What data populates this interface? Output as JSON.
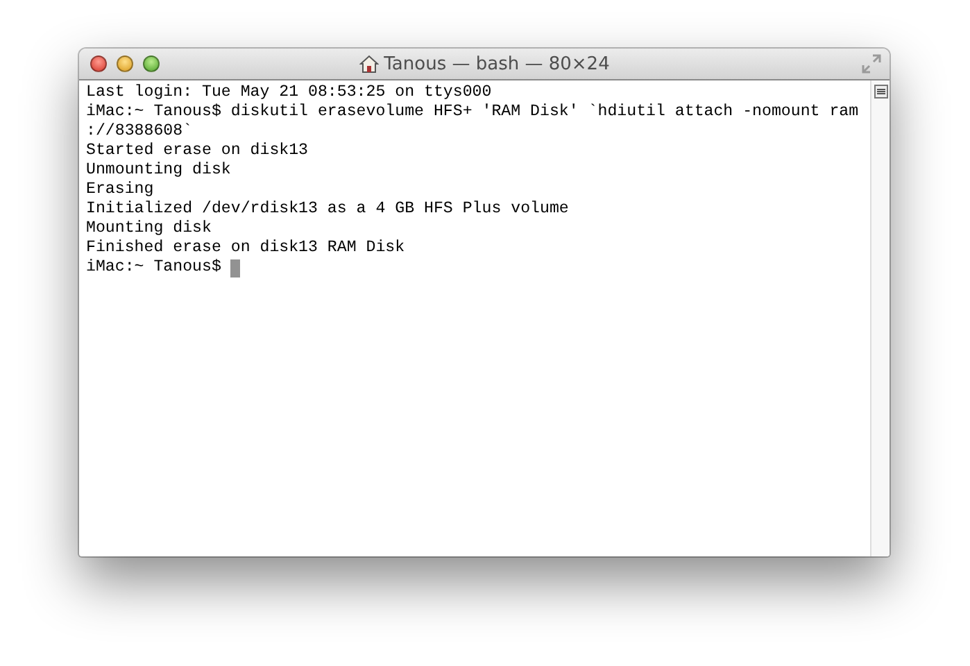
{
  "window": {
    "title": "Tanous — bash — 80×24"
  },
  "terminal": {
    "lines": [
      {
        "text": "Last login: Tue May 21 08:53:25 on ttys000",
        "cursor": false
      },
      {
        "text": "iMac:~ Tanous$ diskutil erasevolume HFS+ 'RAM Disk' `hdiutil attach -nomount ram",
        "cursor": false
      },
      {
        "text": "://8388608`",
        "cursor": false
      },
      {
        "text": "Started erase on disk13",
        "cursor": false
      },
      {
        "text": "Unmounting disk",
        "cursor": false
      },
      {
        "text": "Erasing",
        "cursor": false
      },
      {
        "text": "Initialized /dev/rdisk13 as a 4 GB HFS Plus volume",
        "cursor": false
      },
      {
        "text": "Mounting disk",
        "cursor": false
      },
      {
        "text": "Finished erase on disk13 RAM Disk",
        "cursor": false
      },
      {
        "text": "iMac:~ Tanous$",
        "cursor": true
      }
    ]
  }
}
